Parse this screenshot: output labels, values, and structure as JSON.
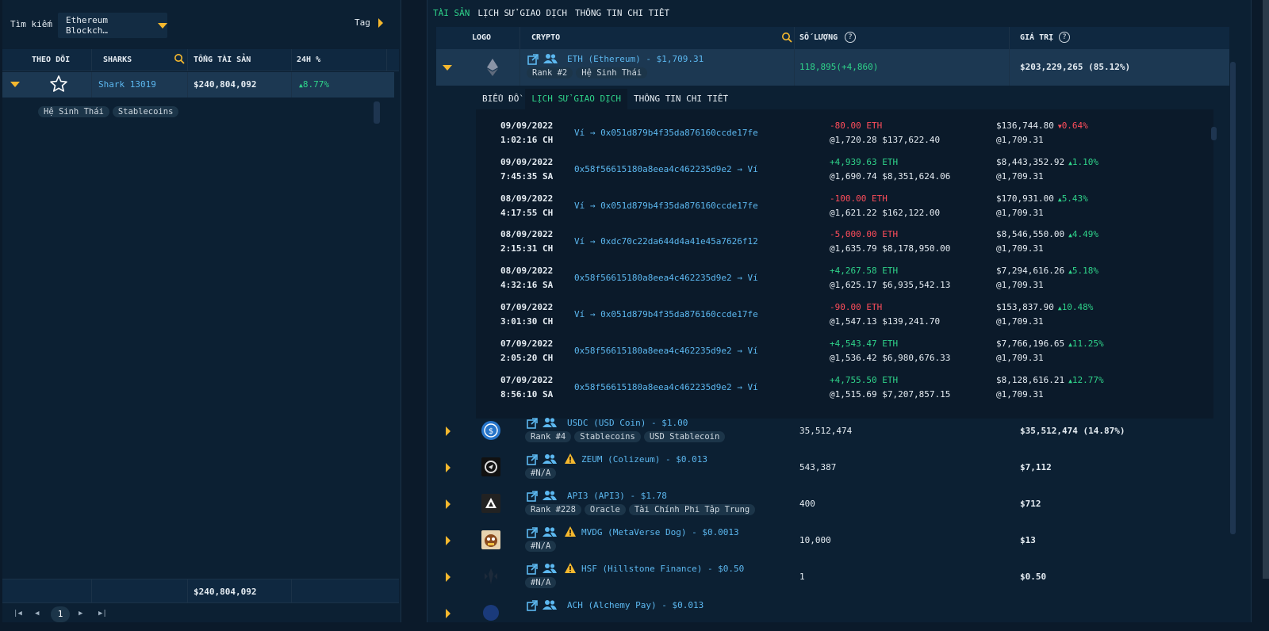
{
  "left": {
    "search_label": "Tìm kiếm",
    "chain_select": "Ethereum Blockch…",
    "tag_label": "Tag",
    "headers": {
      "follow": "THEO DÕI",
      "sharks": "SHARKS",
      "total": "TỔNG TÀI SẢN",
      "change": "24H %"
    },
    "row": {
      "name": "Shark 13019",
      "total": "$240,804,092",
      "change": "8.77%"
    },
    "tags": [
      "Hệ Sinh Thái",
      "Stablecoins"
    ],
    "footer_total": "$240,804,092",
    "page": "1"
  },
  "right": {
    "tabs": [
      "TÀI SẢN",
      "LỊCH SỬ GIAO DỊCH",
      "THÔNG TIN CHI TIẾT"
    ],
    "headers": {
      "logo": "LOGO",
      "crypto": "CRYPTO",
      "qty": "SỐ LƯỢNG",
      "value": "GIÁ TRỊ"
    },
    "eth": {
      "name": "ETH (Ethereum) - $1,709.31",
      "rank": "Rank #2",
      "tag": "Hệ Sinh Thái",
      "qty": "118,895(+4,860)",
      "value": "$203,229,265 (85.12%)"
    },
    "subtabs": [
      "BIỂU ĐỒ",
      "LỊCH SỬ GIAO DỊCH",
      "THÔNG TIN CHI TIẾT"
    ],
    "tx": [
      {
        "date": "09/09/2022",
        "time": "1:02:16 CH",
        "addr": "Ví → 0x051d879b4f35da876160ccde17fe",
        "amount": "-80.00 ETH",
        "price": "@1,720.28 $137,622.40",
        "val": "$136,744.80",
        "pct": "0.64%",
        "up": false,
        "cur": "@1,709.31"
      },
      {
        "date": "09/09/2022",
        "time": "7:45:35 SA",
        "addr": "0x58f56615180a8eea4c462235d9e2 → Ví",
        "amount": "+4,939.63 ETH",
        "price": "@1,690.74 $8,351,624.06",
        "val": "$8,443,352.92",
        "pct": "1.10%",
        "up": true,
        "cur": "@1,709.31"
      },
      {
        "date": "08/09/2022",
        "time": "4:17:55 CH",
        "addr": "Ví → 0x051d879b4f35da876160ccde17fe",
        "amount": "-100.00 ETH",
        "price": "@1,621.22 $162,122.00",
        "val": "$170,931.00",
        "pct": "5.43%",
        "up": true,
        "cur": "@1,709.31"
      },
      {
        "date": "08/09/2022",
        "time": "2:15:31 CH",
        "addr": "Ví → 0xdc70c22da644d4a41e45a7626f12",
        "amount": "-5,000.00 ETH",
        "price": "@1,635.79 $8,178,950.00",
        "val": "$8,546,550.00",
        "pct": "4.49%",
        "up": true,
        "cur": "@1,709.31"
      },
      {
        "date": "08/09/2022",
        "time": "4:32:16 SA",
        "addr": "0x58f56615180a8eea4c462235d9e2 → Ví",
        "amount": "+4,267.58 ETH",
        "price": "@1,625.17 $6,935,542.13",
        "val": "$7,294,616.26",
        "pct": "5.18%",
        "up": true,
        "cur": "@1,709.31"
      },
      {
        "date": "07/09/2022",
        "time": "3:01:30 CH",
        "addr": "Ví → 0x051d879b4f35da876160ccde17fe",
        "amount": "-90.00 ETH",
        "price": "@1,547.13 $139,241.70",
        "val": "$153,837.90",
        "pct": "10.48%",
        "up": true,
        "cur": "@1,709.31"
      },
      {
        "date": "07/09/2022",
        "time": "2:05:20 CH",
        "addr": "0x58f56615180a8eea4c462235d9e2 → Ví",
        "amount": "+4,543.47 ETH",
        "price": "@1,536.42 $6,980,676.33",
        "val": "$7,766,196.65",
        "pct": "11.25%",
        "up": true,
        "cur": "@1,709.31"
      },
      {
        "date": "07/09/2022",
        "time": "8:56:10 SA",
        "addr": "0x58f56615180a8eea4c462235d9e2 → Ví",
        "amount": "+4,755.50 ETH",
        "price": "@1,515.69 $7,207,857.15",
        "val": "$8,128,616.21",
        "pct": "12.77%",
        "up": true,
        "cur": "@1,709.31"
      }
    ],
    "assets": [
      {
        "name": "USDC (USD Coin) - $1.00",
        "warn": false,
        "tags": [
          "Rank #4",
          "Stablecoins",
          "USD Stablecoin"
        ],
        "qty": "35,512,474",
        "value": "$35,512,474 (14.87%)",
        "logo": "usdc-logo"
      },
      {
        "name": "ZEUM (Colizeum) - $0.013",
        "warn": true,
        "tags": [
          "#N/A"
        ],
        "qty": "543,387",
        "value": "$7,112",
        "logo": "zeum-logo"
      },
      {
        "name": "API3 (API3) - $1.78",
        "warn": false,
        "tags": [
          "Rank #228",
          "Oracle",
          "Tài Chính Phi Tập Trung"
        ],
        "qty": "400",
        "value": "$712",
        "logo": "api3-logo"
      },
      {
        "name": "MVDG (MetaVerse Dog) - $0.0013",
        "warn": true,
        "tags": [
          "#N/A"
        ],
        "qty": "10,000",
        "value": "$13",
        "logo": "mvdg-logo"
      },
      {
        "name": "HSF (Hillstone Finance) - $0.50",
        "warn": true,
        "tags": [
          "#N/A"
        ],
        "qty": "1",
        "value": "$0.50",
        "logo": "hsf-logo"
      },
      {
        "name": "ACH (Alchemy Pay) - $0.013",
        "warn": false,
        "tags": [],
        "qty": "",
        "value": "",
        "logo": "ach-logo"
      }
    ]
  }
}
